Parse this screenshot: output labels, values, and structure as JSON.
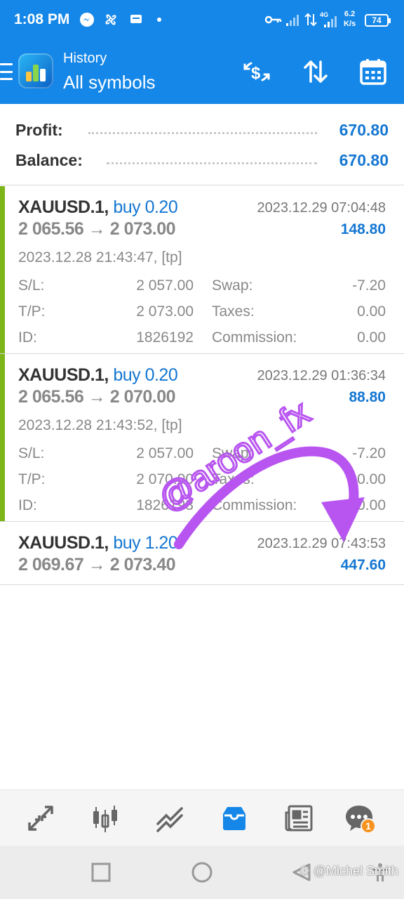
{
  "status_bar": {
    "time": "1:08 PM",
    "speed_value": "6.2",
    "speed_unit": "K/s",
    "network": "4G",
    "battery": "74"
  },
  "header": {
    "subtitle": "History",
    "title": "All symbols"
  },
  "summary": {
    "profit_label": "Profit:",
    "profit_value": "670.80",
    "balance_label": "Balance:",
    "balance_value": "670.80"
  },
  "deals": [
    {
      "symbol": "XAUUSD.1,",
      "direction": "buy 0.20",
      "close_time": "2023.12.29 07:04:48",
      "price_open": "2 065.56",
      "price_close": "2 073.00",
      "profit": "148.80",
      "open_time": "2023.12.28 21:43:47, [tp]",
      "sl_label": "S/L:",
      "sl": "2 057.00",
      "tp_label": "T/P:",
      "tp": "2 073.00",
      "id_label": "ID:",
      "id": "1826192",
      "swap_label": "Swap:",
      "swap": "-7.20",
      "taxes_label": "Taxes:",
      "taxes": "0.00",
      "commission_label": "Commission:",
      "commission": "0.00"
    },
    {
      "symbol": "XAUUSD.1,",
      "direction": "buy 0.20",
      "close_time": "2023.12.29 01:36:34",
      "price_open": "2 065.56",
      "price_close": "2 070.00",
      "profit": "88.80",
      "open_time": "2023.12.28 21:43:52, [tp]",
      "sl_label": "S/L:",
      "sl": "2 057.00",
      "tp_label": "T/P:",
      "tp": "2 070.00",
      "id_label": "ID:",
      "id": "1826193",
      "swap_label": "Swap:",
      "swap": "-7.20",
      "taxes_label": "Taxes:",
      "taxes": "0.00",
      "commission_label": "Commission:",
      "commission": "0.00"
    },
    {
      "symbol": "XAUUSD.1,",
      "direction": "buy 1.20",
      "close_time": "2023.12.29 07:43:53",
      "price_open": "2 069.67",
      "price_close": "2 073.40",
      "profit": "447.60"
    }
  ],
  "price_arrow": "→",
  "watermark": "@aroon_fx",
  "credit": "@Michel Smith",
  "bottom_nav": {
    "items": [
      "quotes-icon",
      "chart-icon",
      "trade-icon",
      "history-icon",
      "news-icon",
      "messages-icon"
    ],
    "messages_badge": "1"
  },
  "colors": {
    "header_bg": "#1587e8",
    "accent_green": "#7cb518",
    "value_blue": "#1577d2",
    "watermark_purple": "#b855f0",
    "badge_orange": "#f7921e"
  }
}
